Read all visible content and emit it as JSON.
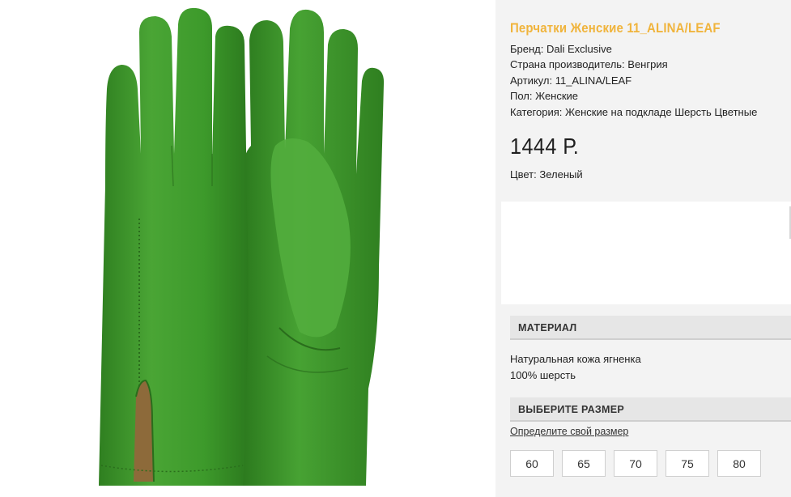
{
  "product": {
    "title": "Перчатки Женские 11_ALINA/LEAF",
    "attributes": [
      "Бренд: Dali Exclusive",
      "Страна производитель: Венгрия",
      "Артикул: 11_ALINA/LEAF",
      "Пол: Женские",
      "Категория: Женские на подкладе Шерсть Цветные"
    ],
    "price": "1444 Р.",
    "color": "Цвет: Зеленый",
    "image_alt": "green-leather-gloves"
  },
  "material": {
    "heading": "МАТЕРИАЛ",
    "lines": [
      "Натуральная кожа ягненка",
      "100% шерсть"
    ]
  },
  "size": {
    "heading": "ВЫБЕРИТЕ РАЗМЕР",
    "link": "Определите свой размер",
    "options": [
      "60",
      "65",
      "70",
      "75",
      "80"
    ]
  },
  "colors": {
    "title": "#f0b43c",
    "glove": "#3f9a2c",
    "panel": "#f3f3f3"
  }
}
